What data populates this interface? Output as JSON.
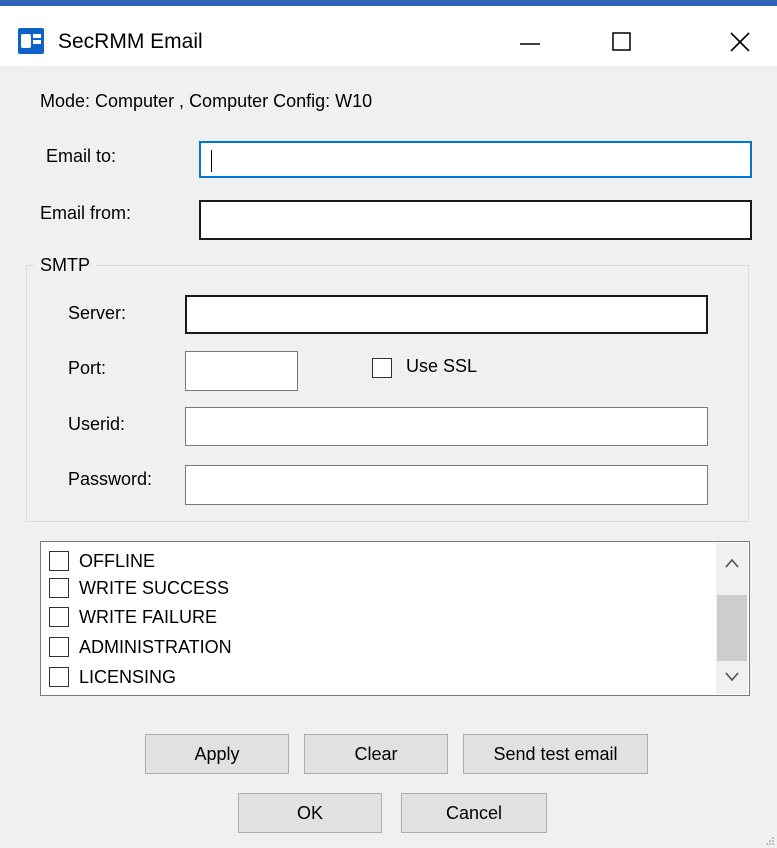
{
  "window": {
    "title": "SecRMM Email",
    "icon": "outlook-icon",
    "controls": {
      "minimize": "—",
      "maximize": "☐",
      "close": "✕"
    }
  },
  "mode_text": "Mode: Computer , Computer Config: W10",
  "fields": {
    "email_to_label": "Email to:",
    "email_to_value": "",
    "email_from_label": "Email from:",
    "email_from_value": ""
  },
  "smtp": {
    "group_label": "SMTP",
    "server_label": "Server:",
    "server_value": "",
    "port_label": "Port:",
    "port_value": "",
    "use_ssl_label": "Use SSL",
    "use_ssl_checked": false,
    "userid_label": "Userid:",
    "userid_value": "",
    "password_label": "Password:",
    "password_value": ""
  },
  "events": [
    {
      "label": "OFFLINE",
      "checked": false
    },
    {
      "label": "WRITE SUCCESS",
      "checked": false
    },
    {
      "label": "WRITE FAILURE",
      "checked": false
    },
    {
      "label": "ADMINISTRATION",
      "checked": false
    },
    {
      "label": "LICENSING",
      "checked": false
    }
  ],
  "buttons": {
    "apply": "Apply",
    "clear": "Clear",
    "send_test": "Send test email",
    "ok": "OK",
    "cancel": "Cancel"
  },
  "colors": {
    "focus_border": "#0078d7",
    "dialog_bg": "#f0f0f0",
    "button_bg": "#e1e1e1"
  }
}
